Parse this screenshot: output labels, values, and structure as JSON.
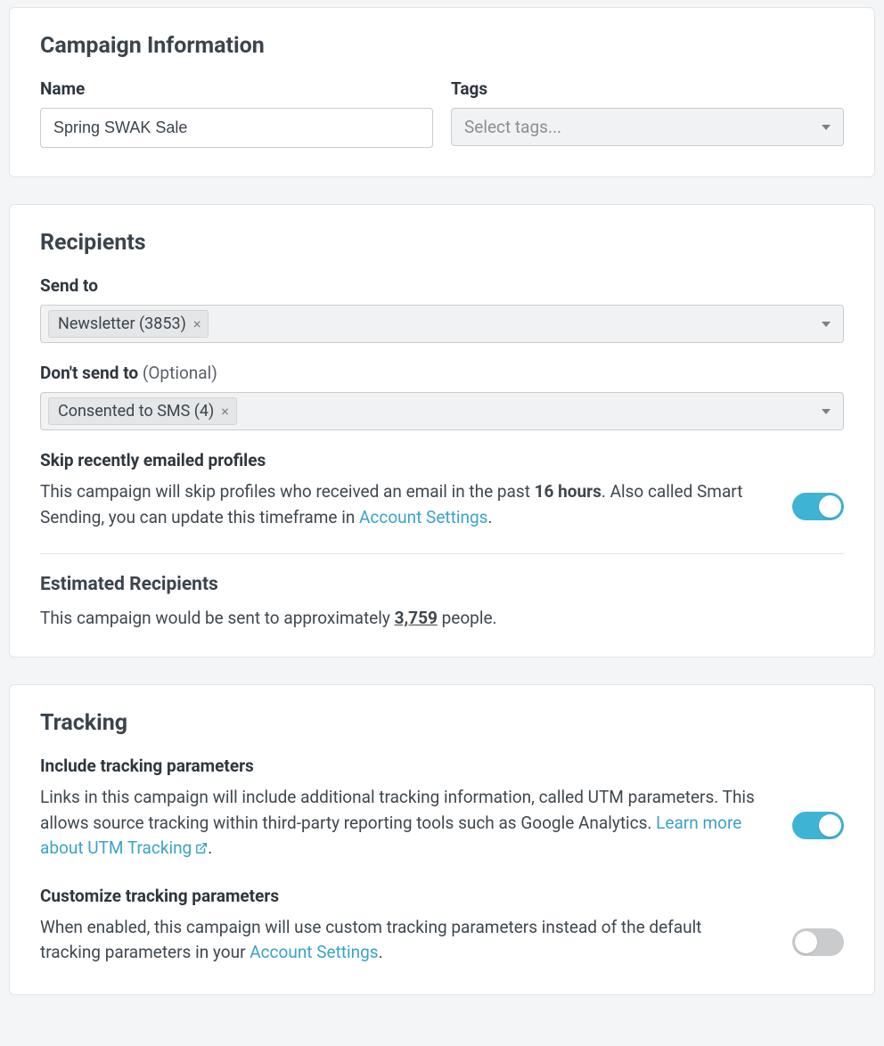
{
  "campaign_info": {
    "title": "Campaign Information",
    "name_label": "Name",
    "name_value": "Spring SWAK Sale",
    "tags_label": "Tags",
    "tags_placeholder": "Select tags..."
  },
  "recipients": {
    "title": "Recipients",
    "send_to_label": "Send to",
    "send_to_chip": "Newsletter (3853)",
    "dont_send_label": "Don't send to",
    "dont_send_optional": "(Optional)",
    "dont_send_chip": "Consented to SMS (4)",
    "skip_heading": "Skip recently emailed profiles",
    "skip_text_a": "This campaign will skip profiles who received an email in the past ",
    "skip_hours": "16 hours",
    "skip_text_b": ". Also called Smart Sending, you can update this timeframe in ",
    "skip_link": "Account Settings",
    "skip_text_c": ".",
    "est_heading": "Estimated Recipients",
    "est_text_a": "This campaign would be sent to approximately ",
    "est_count": "3,759",
    "est_text_b": " people."
  },
  "tracking": {
    "title": "Tracking",
    "include_heading": "Include tracking parameters",
    "include_text_a": "Links in this campaign will include additional tracking information, called UTM parameters. This allows source tracking within third-party reporting tools such as Google Analytics. ",
    "include_link": "Learn more about UTM Tracking",
    "include_text_b": ".",
    "customize_heading": "Customize tracking parameters",
    "customize_text_a": "When enabled, this campaign will use custom tracking parameters instead of the default tracking parameters in your ",
    "customize_link": "Account Settings",
    "customize_text_b": "."
  }
}
